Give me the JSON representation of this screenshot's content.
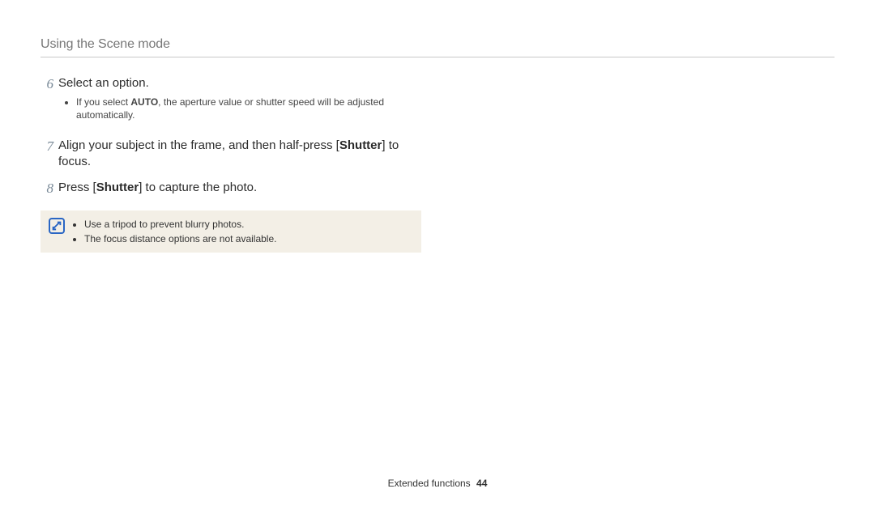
{
  "header": {
    "title": "Using the Scene mode"
  },
  "steps": {
    "s6": {
      "num": "6",
      "text": "Select an option.",
      "bullet_pre": "If you select ",
      "bullet_strong": "AUTO",
      "bullet_post": ", the aperture value or shutter speed will be adjusted automatically."
    },
    "s7": {
      "num": "7",
      "pre": "Align your subject in the frame, and then half-press [",
      "strong": "Shutter",
      "post": "] to focus."
    },
    "s8": {
      "num": "8",
      "pre": "Press [",
      "strong": "Shutter",
      "post": "] to capture the photo."
    }
  },
  "note": {
    "b1": "Use a tripod to prevent blurry photos.",
    "b2": "The focus distance options are not available."
  },
  "footer": {
    "section": "Extended functions",
    "page": "44"
  }
}
